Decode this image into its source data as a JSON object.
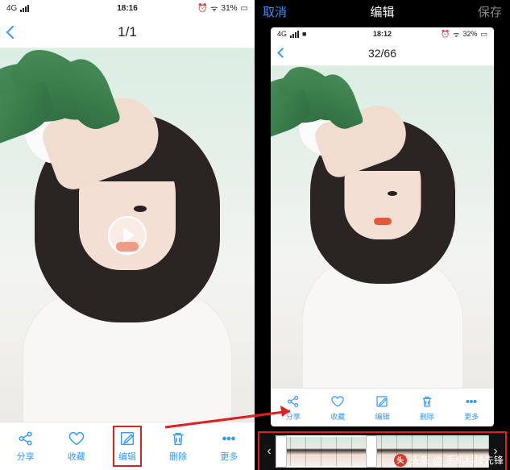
{
  "left": {
    "status": {
      "network": "4G",
      "time": "18:16",
      "battery": "31%"
    },
    "nav": {
      "counter": "1/1"
    },
    "toolbar": {
      "share": "分享",
      "favorite": "收藏",
      "edit": "编辑",
      "delete": "删除",
      "more": "更多"
    }
  },
  "right": {
    "header": {
      "cancel": "取消",
      "title": "编辑",
      "save": "保存"
    },
    "inner": {
      "status": {
        "network": "4G",
        "time": "18:12",
        "battery": "32%"
      },
      "nav": {
        "counter": "32/66"
      },
      "toolbar": {
        "share": "分享",
        "favorite": "收藏",
        "edit": "编辑",
        "delete": "删除",
        "more": "更多"
      }
    },
    "timeline": {
      "thumb_count": 14
    }
  },
  "watermark": {
    "prefix": "头条",
    "at": "@",
    "author": "手机科技先锋"
  }
}
